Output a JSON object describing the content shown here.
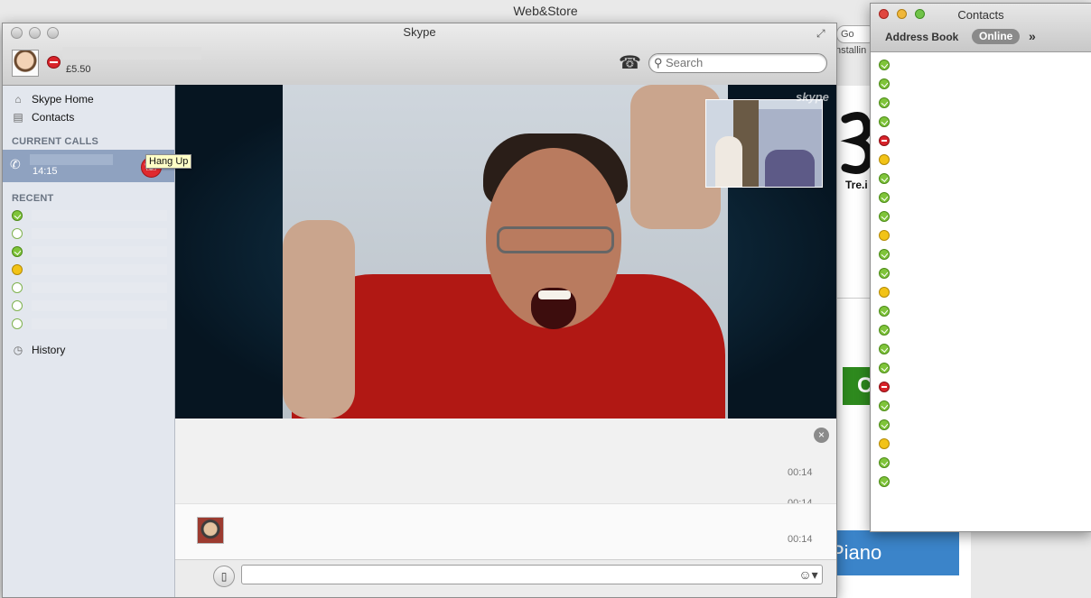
{
  "background_window": {
    "title": "Web&Store",
    "search_fragment": "Go",
    "status_fragment": "nstallin",
    "tre_text": "Tre.i",
    "green_button_fragment": "C",
    "banner_fragment": "Piano"
  },
  "skype": {
    "title": "Skype",
    "account": {
      "credit": "£5.50",
      "status": "dnd"
    },
    "search": {
      "placeholder": "Search"
    },
    "sidebar": {
      "nav": [
        {
          "label": "Skype Home",
          "icon": "home-icon"
        },
        {
          "label": "Contacts",
          "icon": "contacts-book-icon"
        }
      ],
      "current_calls_header": "CURRENT CALLS",
      "current_call": {
        "duration": "14:15"
      },
      "hangup_tooltip": "Hang Up",
      "recent_header": "RECENT",
      "recent_statuses": [
        "online",
        "offline",
        "online",
        "away",
        "offline",
        "offline",
        "offline"
      ],
      "history_label": "History"
    },
    "video": {
      "watermark": "skype"
    },
    "chat": {
      "timestamps": [
        "00:14",
        "00:14",
        "00:14"
      ]
    }
  },
  "contacts": {
    "title": "Contacts",
    "address_book": "Address Book",
    "filter": "Online",
    "more": "»",
    "statuses": [
      "online",
      "online",
      "online",
      "online",
      "dnd",
      "away",
      "online",
      "online",
      "online",
      "away",
      "online",
      "online",
      "away",
      "online",
      "online",
      "online",
      "online",
      "dnd",
      "online",
      "online",
      "away",
      "online",
      "online"
    ]
  },
  "colors": {
    "online": "#7fc43a",
    "away": "#f2c317",
    "dnd": "#d8232a",
    "call_row": "#8fa2c0",
    "hangup": "#e02a2f"
  }
}
